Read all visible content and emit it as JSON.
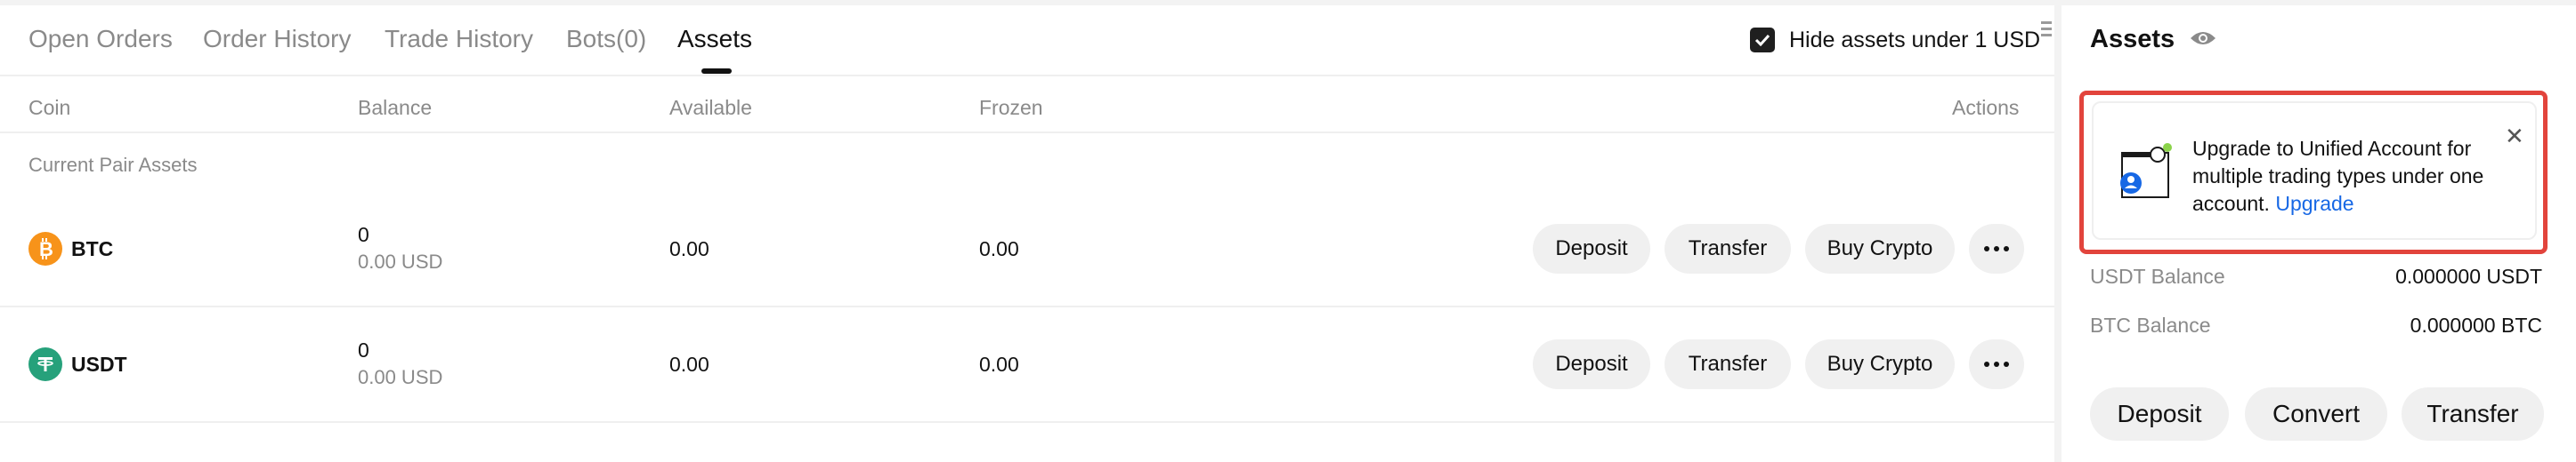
{
  "tabs": [
    "Open Orders",
    "Order History",
    "Trade History",
    "Bots(0)",
    "Assets"
  ],
  "active_tab": "Assets",
  "hide_assets": {
    "label": "Hide assets under 1 USD",
    "checked": true
  },
  "columns": {
    "coin": "Coin",
    "balance": "Balance",
    "available": "Available",
    "frozen": "Frozen",
    "actions": "Actions"
  },
  "section_label": "Current Pair Assets",
  "rows": [
    {
      "coin": "BTC",
      "icon": "bitcoin-icon",
      "icon_color": "#f7931a",
      "balance": "0",
      "balance_usd": "0.00 USD",
      "available": "0.00",
      "frozen": "0.00",
      "actions": {
        "deposit": "Deposit",
        "transfer": "Transfer",
        "buy": "Buy Crypto"
      }
    },
    {
      "coin": "USDT",
      "icon": "tether-icon",
      "icon_color": "#26a17b",
      "balance": "0",
      "balance_usd": "0.00 USD",
      "available": "0.00",
      "frozen": "0.00",
      "actions": {
        "deposit": "Deposit",
        "transfer": "Transfer",
        "buy": "Buy Crypto"
      }
    }
  ],
  "panel": {
    "title": "Assets",
    "banner": {
      "text": "Upgrade to Unified Account for multiple trading types under one account.",
      "link": "Upgrade"
    },
    "balances": [
      {
        "label": "USDT Balance",
        "value": "0.000000 USDT"
      },
      {
        "label": "BTC Balance",
        "value": "0.000000 BTC"
      }
    ],
    "buttons": {
      "deposit": "Deposit",
      "convert": "Convert",
      "transfer": "Transfer"
    }
  },
  "colors": {
    "accent_link": "#1768e5",
    "highlight_border": "#e2443c"
  }
}
